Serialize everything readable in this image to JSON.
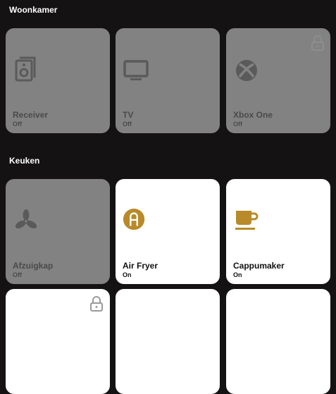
{
  "colors": {
    "background": "#141213",
    "tile_off": "#828282",
    "tile_on": "#ffffff",
    "accent": "#b88a2a"
  },
  "sections": [
    {
      "title": "Woonkamer",
      "tiles": [
        {
          "name": "Receiver",
          "state": "Off",
          "icon": "speaker-icon"
        },
        {
          "name": "TV",
          "state": "Off",
          "icon": "tv-icon"
        },
        {
          "name": "Xbox One",
          "state": "Off",
          "icon": "xbox-icon",
          "locked": true
        }
      ]
    },
    {
      "title": "Keuken",
      "tiles": [
        {
          "name": "Afzuigkap",
          "state": "Off",
          "icon": "fan-icon"
        },
        {
          "name": "Air Fryer",
          "state": "On",
          "icon": "air-fryer-icon"
        },
        {
          "name": "Cappumaker",
          "state": "On",
          "icon": "coffee-cup-icon"
        }
      ]
    }
  ]
}
